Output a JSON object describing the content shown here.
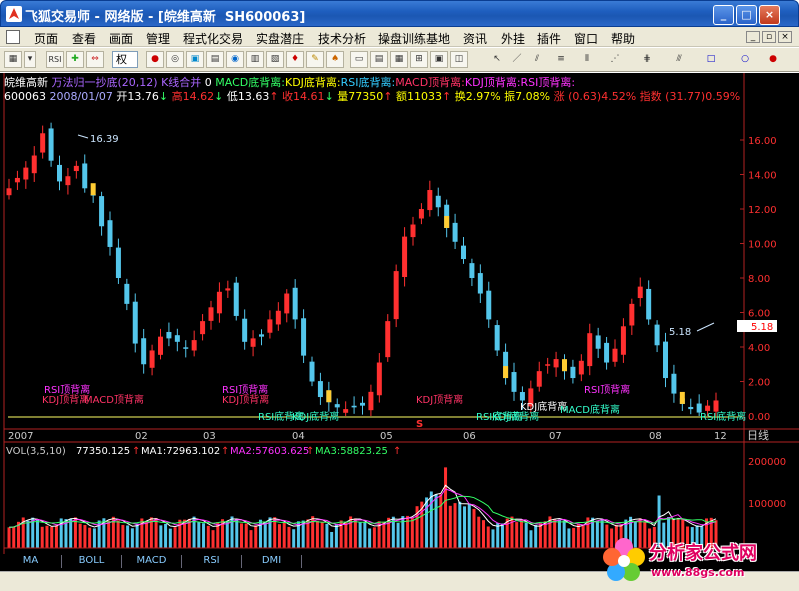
{
  "window": {
    "title": "飞狐交易师 - 网络版 - [皖维高新  SH600063]",
    "minimize": "_",
    "maximize": "□",
    "close": "×"
  },
  "menu": {
    "items": [
      "页面",
      "查看",
      "画面",
      "管理",
      "程式化交易",
      "实盘潜庄",
      "技术分析",
      "操盘训练基地",
      "资讯",
      "外挂",
      "插件",
      "窗口",
      "帮助"
    ]
  },
  "toolbar": {
    "right_label": "权",
    "rsi_label": "RSI"
  },
  "indicator_line": {
    "stock_name": "皖维高新",
    "formula": "万法归一抄底(20,12)",
    "kline": "K线合并",
    "kline_val": "0",
    "div_macd_bottom": "MACD底背离:",
    "div_kdj_bottom": "KDJ底背离:",
    "div_rsi_bottom": "RSI底背离:",
    "div_macd_top": "MACD顶背离:",
    "div_kdj_top": "KDJ顶背离:",
    "div_rsi_top": "RSI顶背离:"
  },
  "quote_line": {
    "code": "600063",
    "date": "2008/01/07",
    "open": "开13.76",
    "high": "高14.62",
    "low": "低13.63",
    "close": "收14.61",
    "volume": "量77350",
    "amount": "额11033",
    "turnover": "换2.97%",
    "amplitude": "振7.08%",
    "change": "涨 (0.63)4.52%",
    "index": "指数 (31.77)0.59%"
  },
  "price_axis": {
    "ticks": [
      "16.00",
      "14.00",
      "12.00",
      "10.00",
      "8.00",
      "6.00",
      "4.00",
      "2.00",
      "0.00"
    ],
    "current_price": "5.18"
  },
  "annotations": {
    "high_label": "16.39",
    "low_label": "5.18",
    "signal_marker": "S",
    "labels": [
      {
        "text": "RSI顶背离",
        "color": "#ff33ff"
      },
      {
        "text": "KDJ顶背离",
        "color": "#ff3366"
      },
      {
        "text": "MACD顶背离",
        "color": "#ff3366"
      },
      {
        "text": "RSI顶背离",
        "color": "#ff33ff"
      },
      {
        "text": "KDJ顶背离",
        "color": "#ff3366"
      },
      {
        "text": "RSI底背离",
        "color": "#33ffcc"
      },
      {
        "text": "KDJ底背离",
        "color": "#33ffcc"
      },
      {
        "text": "KDJ顶背离",
        "color": "#ff3366"
      },
      {
        "text": "RSI底背离",
        "color": "#33ffcc"
      },
      {
        "text": "KDJ底背离",
        "color": "#33ffcc"
      },
      {
        "text": "KDJ底背离",
        "color": "#ffffff"
      },
      {
        "text": "MACD底背离",
        "color": "#33ffcc"
      },
      {
        "text": "RSI顶背离",
        "color": "#ff33ff"
      },
      {
        "text": "RSI底背离",
        "color": "#33ffcc"
      }
    ]
  },
  "time_axis": {
    "labels": [
      "2007",
      "02",
      "03",
      "04",
      "05",
      "06",
      "07",
      "08",
      "12"
    ],
    "period": "日线"
  },
  "volume_panel": {
    "title": "VOL(3,5,10)",
    "vol": "77350.125",
    "ma1": "MA1:72963.102",
    "ma2": "MA2:57603.625",
    "ma3": "MA3:58823.25",
    "up_arrow": "↑",
    "down_arrow": "↓",
    "ticks": [
      "200000",
      "100000"
    ]
  },
  "tabs": [
    "MA",
    "BOLL",
    "MACD",
    "RSI",
    "DMI"
  ],
  "watermark": {
    "name": "分析家公式网",
    "url": "www.88gs.com"
  },
  "colors": {
    "background": "#000000",
    "up": "#ff3030",
    "down": "#54c6eb",
    "axis": "#b22222",
    "yellow": "#ffcc33",
    "ma1": "#ffffff",
    "ma2": "#ff33ff",
    "ma3": "#33ff66"
  },
  "chart_data": {
    "type": "candlestick",
    "ylim": [
      0,
      17
    ],
    "close": [
      13.2,
      13.8,
      14.4,
      15.1,
      16.39,
      14.8,
      13.6,
      13.9,
      14.5,
      13.2,
      12.8,
      11.0,
      9.8,
      8.0,
      6.5,
      4.2,
      3.0,
      3.8,
      4.6,
      4.5,
      4.3,
      3.9,
      4.4,
      5.5,
      6.3,
      7.2,
      7.4,
      5.8,
      4.3,
      4.5,
      4.6,
      5.6,
      6.1,
      7.1,
      5.6,
      3.5,
      2.0,
      1.1,
      0.8,
      0.5,
      0.4,
      0.5,
      0.6,
      1.4,
      3.1,
      5.5,
      8.4,
      10.4,
      11.1,
      12.0,
      13.1,
      12.1,
      10.9,
      10.1,
      9.1,
      8.0,
      7.1,
      5.6,
      3.8,
      2.2,
      1.4,
      0.9,
      1.6,
      2.6,
      3.0,
      3.3,
      2.6,
      2.2,
      3.2,
      4.8,
      3.9,
      3.1,
      3.9,
      5.2,
      6.5,
      7.5,
      5.6,
      4.1,
      2.2,
      1.3,
      0.7,
      0.4,
      0.2,
      0.6,
      0.9
    ],
    "volume_ylim": [
      0,
      240000
    ]
  }
}
